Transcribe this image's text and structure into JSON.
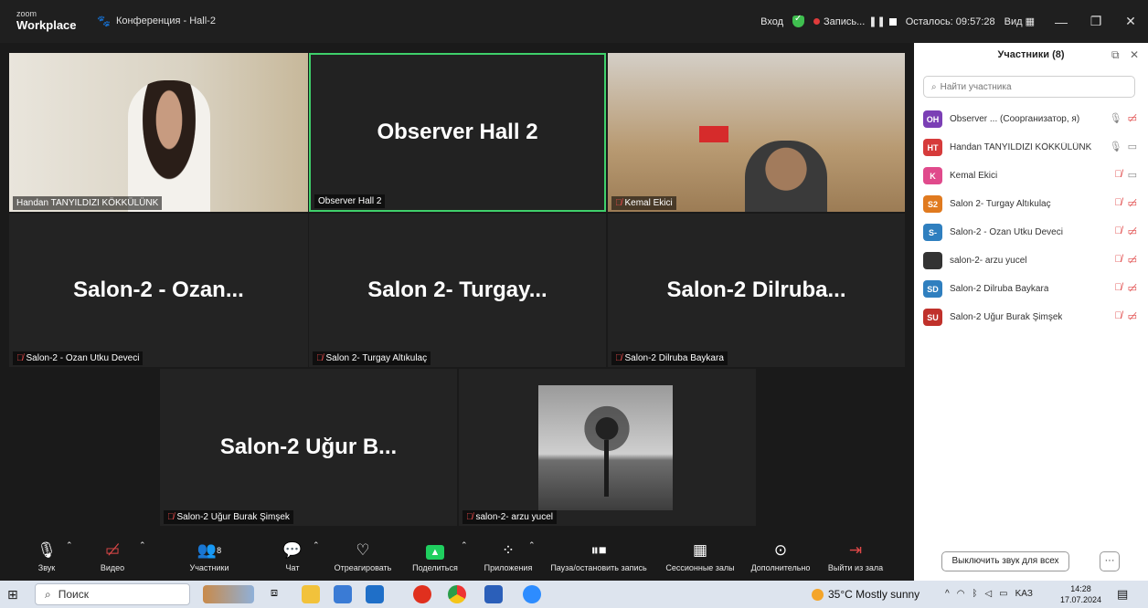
{
  "titlebar": {
    "logo_top": "zoom",
    "logo_bottom": "Workplace",
    "meeting_title": "Конференция - Hall-2",
    "login": "Вход",
    "recording": "Запись...",
    "time_left": "Осталось: 09:57:28",
    "view": "Вид"
  },
  "tiles": [
    {
      "big": "",
      "tag": "Handan TANYILDIZI KÖKKÜLÜNK",
      "muted": false
    },
    {
      "big": "Observer Hall 2",
      "tag": "Observer Hall 2",
      "muted": false
    },
    {
      "big": "",
      "tag": "Kemal Ekici",
      "muted": true
    },
    {
      "big": "Salon-2 - Ozan...",
      "tag": "Salon-2 - Ozan Utku Deveci",
      "muted": true
    },
    {
      "big": "Salon 2- Turgay...",
      "tag": "Salon 2- Turgay Altıkulaç",
      "muted": true
    },
    {
      "big": "Salon-2 Dilruba...",
      "tag": "Salon-2 Dilruba Baykara",
      "muted": true
    },
    {
      "big": "Salon-2 Uğur B...",
      "tag": "Salon-2 Uğur Burak Şimşek",
      "muted": true
    },
    {
      "big": "",
      "tag": "salon-2- arzu yucel",
      "muted": true
    }
  ],
  "controls": {
    "audio": "Звук",
    "video": "Видео",
    "participants": "Участники",
    "participants_count": "8",
    "chat": "Чат",
    "react": "Отреагировать",
    "share": "Поделиться",
    "apps": "Приложения",
    "pause_rec": "Пауза/остановить запись",
    "breakout": "Сессионные залы",
    "more": "Дополнительно",
    "leave": "Выйти из зала"
  },
  "panel": {
    "title": "Участники (8)",
    "search_placeholder": "Найти участника",
    "participants": [
      {
        "initials": "OH",
        "color": "#7b3fb5",
        "name": "Observer ... (Соорганизатор, я)"
      },
      {
        "initials": "HT",
        "color": "#d63b3b",
        "name": "Handan TANYILDIZI KÖKKÜLÜNK"
      },
      {
        "initials": "K",
        "color": "#e04a8c",
        "name": "Kemal Ekici"
      },
      {
        "initials": "S2",
        "color": "#e07a1f",
        "name": "Salon 2- Turgay Altıkulaç"
      },
      {
        "initials": "S-",
        "color": "#2f7fbf",
        "name": "Salon-2 - Ozan Utku Deveci"
      },
      {
        "initials": "",
        "color": "#333333",
        "name": "salon-2- arzu yucel"
      },
      {
        "initials": "SD",
        "color": "#2f7fbf",
        "name": "Salon-2 Dilruba Baykara"
      },
      {
        "initials": "SU",
        "color": "#c0312b",
        "name": "Salon-2 Uğur Burak Şimşek"
      }
    ],
    "mute_all": "Выключить звук для всех",
    "more": "···"
  },
  "taskbar": {
    "search": "Поиск",
    "weather": "35°C Mostly sunny",
    "lang": "KAЗ",
    "time": "14:28",
    "date": "17.07.2024"
  }
}
